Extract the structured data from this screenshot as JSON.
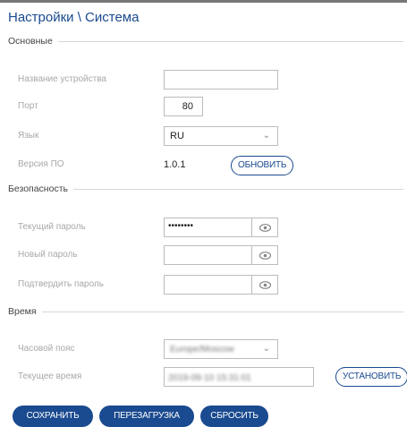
{
  "title": "Настройки \\ Система",
  "sections": {
    "basic": {
      "legend": "Основные",
      "device_name_label": "Название устройства",
      "device_name_value": "",
      "port_label": "Порт",
      "port_value": "80",
      "language_label": "Язык",
      "language_value": "RU",
      "firmware_label": "Версия ПО",
      "firmware_value": "1.0.1",
      "update_button": "ОБНОВИТЬ"
    },
    "security": {
      "legend": "Безопасность",
      "current_password_label": "Текущий пароль",
      "current_password_value": "••••••••",
      "new_password_label": "Новый пароль",
      "confirm_password_label": "Подтвердить пароль"
    },
    "time": {
      "legend": "Время",
      "timezone_label": "Часовой пояс",
      "timezone_value": "Europe/Moscow",
      "current_time_label": "Текущее время",
      "current_time_value": "2019-09-10 15:31:01",
      "set_button": "УСТАНОВИТЬ"
    }
  },
  "footer": {
    "save": "СОХРАНИТЬ",
    "reboot": "ПЕРЕЗАГРУЗКА",
    "reset": "СБРОСИТЬ"
  },
  "colors": {
    "accent": "#1a4a8f",
    "label": "#a8a8a8",
    "border": "#bcbcbc"
  },
  "icons": {
    "password_toggle": "eye-icon",
    "dropdown": "chevron-down-icon"
  }
}
